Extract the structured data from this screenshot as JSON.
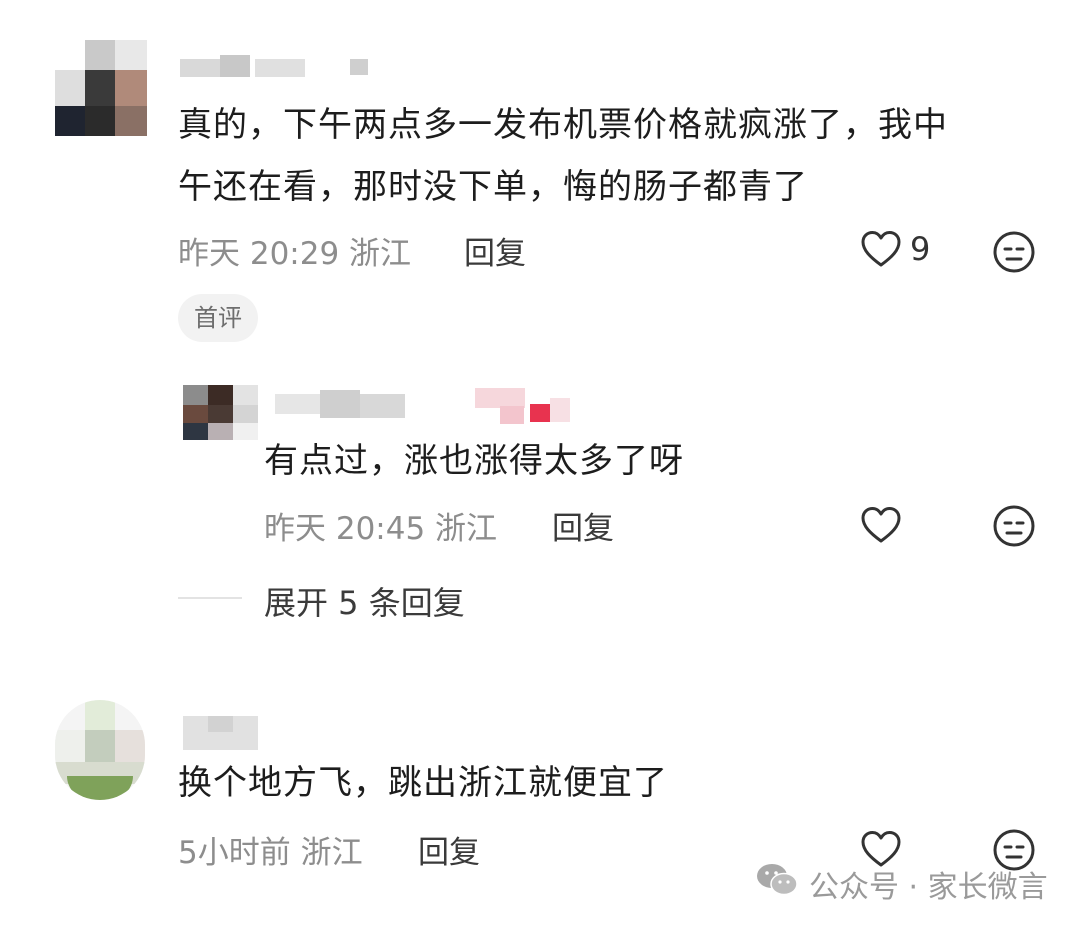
{
  "comments": [
    {
      "text_lines": [
        "真的，下午两点多一发布机票价格就疯涨了，我中",
        "午还在看，那时没下单，悔的肠子都青了"
      ],
      "time": "昨天 20:29 浙江",
      "reply_label": "回复",
      "likes": "9",
      "badge": "首评"
    },
    {
      "text_lines": [
        "换个地方飞，跳出浙江就便宜了"
      ],
      "time": "5小时前 浙江",
      "reply_label": "回复"
    }
  ],
  "reply": {
    "text": "有点过，涨也涨得太多了呀",
    "time": "昨天 20:45 浙江",
    "reply_label": "回复"
  },
  "expand_replies": "展开 5 条回复",
  "watermark": "公众号 · 家长微言",
  "icons": {
    "like": "heart-icon",
    "dislike": "neutral-face-icon",
    "watermark": "wechat-icon"
  }
}
